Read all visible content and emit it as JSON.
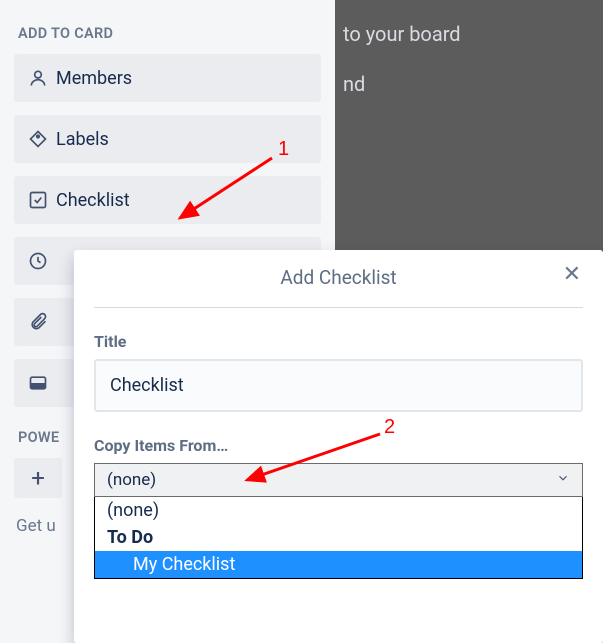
{
  "sidebar": {
    "sectionTitle": "ADD TO CARD",
    "items": [
      {
        "label": "Members"
      },
      {
        "label": "Labels"
      },
      {
        "label": "Checklist"
      },
      {
        "label": ""
      },
      {
        "label": ""
      },
      {
        "label": ""
      }
    ],
    "powerUps": "POWE",
    "footer": "Get u"
  },
  "board": {
    "line1": "to your board",
    "line2": "nd"
  },
  "popup": {
    "title": "Add Checklist",
    "titleLabel": "Title",
    "titleValue": "Checklist",
    "copyLabel": "Copy Items From…",
    "selectedOption": "(none)",
    "options": {
      "none": "(none)",
      "group": "To Do",
      "item": "My Checklist"
    }
  },
  "annotations": {
    "num1": "1",
    "num2": "2"
  }
}
